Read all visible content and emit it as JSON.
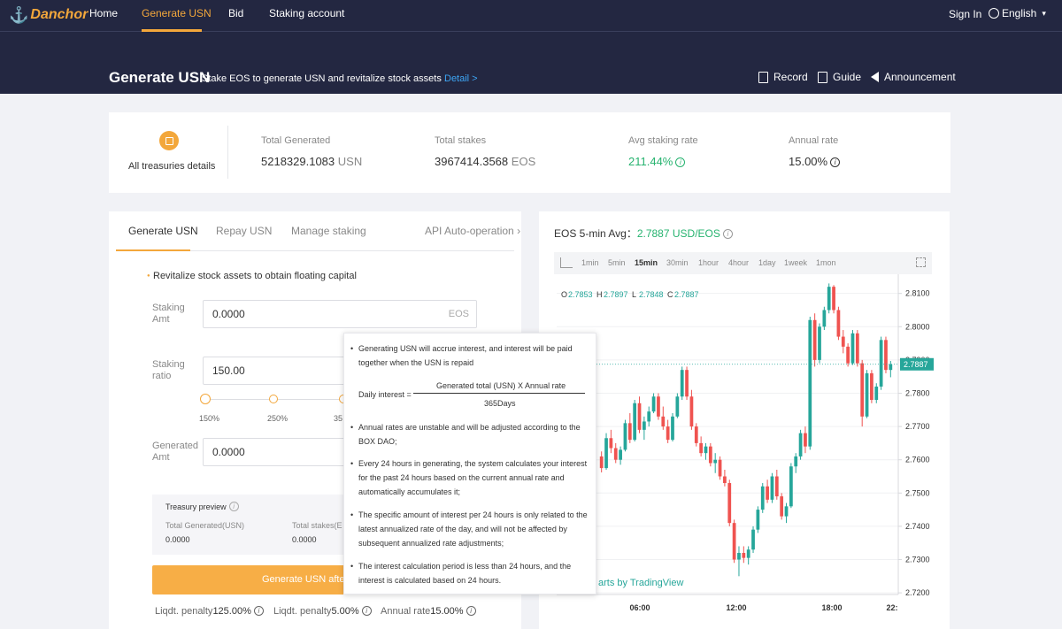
{
  "nav": {
    "logo": "Danchor",
    "items": [
      "Home",
      "Generate USN",
      "Bid",
      "Staking account"
    ],
    "signin": "Sign In",
    "language": "English"
  },
  "subheader": {
    "title": "Generate USN",
    "subtitle": "Stake EOS to generate USN and revitalize stock assets .",
    "detail": "Detail >",
    "links": [
      "Record",
      "Guide",
      "Announcement"
    ]
  },
  "stats": {
    "treasury_label": "All treasuries details",
    "total_generated_label": "Total Generated",
    "total_generated_value": "5218329.1083",
    "total_generated_unit": "USN",
    "total_stakes_label": "Total stakes",
    "total_stakes_value": "3967414.3568",
    "total_stakes_unit": "EOS",
    "avg_rate_label": "Avg staking rate",
    "avg_rate_value": "211.44%",
    "annual_rate_label": "Annual rate",
    "annual_rate_value": "15.00%"
  },
  "left": {
    "tabs": [
      "Generate USN",
      "Repay USN",
      "Manage staking"
    ],
    "api": "API Auto-operation",
    "bullet": "Revitalize stock assets to obtain floating capital",
    "staking_amt_label": "Staking Amt",
    "staking_amt_value": "0.0000",
    "staking_amt_unit": "EOS",
    "staking_ratio_label": "Staking ratio",
    "staking_ratio_value": "150.00",
    "slider_labels": [
      "150%",
      "250%",
      "35"
    ],
    "generated_amt_label": "Generated Amt",
    "generated_amt_value": "0.0000",
    "preview_title": "Treasury preview",
    "preview_total_gen_label": "Total Generated(USN)",
    "preview_total_gen_value": "0.0000",
    "preview_total_stakes_label": "Total stakes(E",
    "preview_total_stakes_value": "0.0000",
    "button": "Generate USN afte",
    "footer_1_label": "Liqdt. penalty",
    "footer_1_value": "125.00%",
    "footer_2_label": "Liqdt. penalty",
    "footer_2_value": "5.00%",
    "footer_3_label": "Annual rate",
    "footer_3_value": "15.00%"
  },
  "tooltip": {
    "item1": "Generating USN will accrue interest, and interest will be paid together when the USN is repaid",
    "formula_label": "Daily interest =",
    "formula_numerator": "Generated total (USN) X Annual rate",
    "formula_denominator": "365Days",
    "item2": "Annual rates are unstable and will be adjusted according to the BOX DAO;",
    "item3": "Every 24 hours in generating, the system calculates your interest for the past 24 hours based on the current annual rate and automatically accumulates it;",
    "item4": "The specific amount of interest per 24 hours is only related to the latest annualized rate of the day, and will not be affected by subsequent annualized rate adjustments;",
    "item5": "The interest calculation period is less than 24 hours, and the interest is calculated based on 24 hours."
  },
  "chart": {
    "title_prefix": "EOS 5-min Avg：",
    "title_value": "2.7887 USD/EOS",
    "intervals": [
      "1min",
      "5min",
      "15min",
      "30min",
      "1hour",
      "4hour",
      "1day",
      "1week",
      "1mon"
    ],
    "active_interval": "15min",
    "tradingview": "arts by TradingView"
  },
  "chart_data": {
    "type": "candlestick",
    "ohlc_legend": {
      "O": "2.7853",
      "H": "2.7897",
      "L": "2.7848",
      "C": "2.7887"
    },
    "y_ticks": [
      "2.8100",
      "2.8000",
      "2.7900",
      "2.7800",
      "2.7700",
      "2.7600",
      "2.7500",
      "2.7400",
      "2.7300",
      "2.7200"
    ],
    "x_ticks": [
      "06:00",
      "12:00",
      "18:00",
      "22:"
    ],
    "current_price": "2.7887",
    "ylim": [
      2.7195,
      2.8147
    ],
    "colors": {
      "up": "#26a69a",
      "down": "#ef5350"
    },
    "candles": [
      [
        2.761,
        2.7625,
        2.7562,
        2.7575
      ],
      [
        2.7575,
        2.768,
        2.757,
        2.7665
      ],
      [
        2.7665,
        2.769,
        2.762,
        2.7635
      ],
      [
        2.7635,
        2.765,
        2.759,
        2.76
      ],
      [
        2.76,
        2.764,
        2.7585,
        2.763
      ],
      [
        2.763,
        2.772,
        2.7625,
        2.771
      ],
      [
        2.771,
        2.774,
        2.765,
        2.766
      ],
      [
        2.766,
        2.778,
        2.7655,
        2.777
      ],
      [
        2.777,
        2.779,
        2.768,
        2.769
      ],
      [
        2.769,
        2.773,
        2.766,
        2.7715
      ],
      [
        2.7715,
        2.776,
        2.77,
        2.7745
      ],
      [
        2.7745,
        2.78,
        2.774,
        2.779
      ],
      [
        2.779,
        2.78,
        2.772,
        2.773
      ],
      [
        2.773,
        2.776,
        2.769,
        2.77
      ],
      [
        2.77,
        2.772,
        2.765,
        2.766
      ],
      [
        2.766,
        2.774,
        2.7655,
        2.773
      ],
      [
        2.773,
        2.78,
        2.7725,
        2.779
      ],
      [
        2.779,
        2.788,
        2.778,
        2.787
      ],
      [
        2.787,
        2.788,
        2.778,
        2.779
      ],
      [
        2.779,
        2.781,
        2.769,
        2.77
      ],
      [
        2.77,
        2.771,
        2.764,
        2.765
      ],
      [
        2.765,
        2.767,
        2.761,
        2.762
      ],
      [
        2.762,
        2.765,
        2.76,
        2.764
      ],
      [
        2.764,
        2.765,
        2.758,
        2.759
      ],
      [
        2.759,
        2.762,
        2.756,
        2.76
      ],
      [
        2.76,
        2.761,
        2.754,
        2.755
      ],
      [
        2.755,
        2.757,
        2.752,
        2.753
      ],
      [
        2.753,
        2.754,
        2.74,
        2.741
      ],
      [
        2.741,
        2.742,
        2.729,
        2.73
      ],
      [
        2.73,
        2.734,
        2.725,
        2.732
      ],
      [
        2.732,
        2.734,
        2.729,
        2.7305
      ],
      [
        2.7305,
        2.734,
        2.7285,
        2.733
      ],
      [
        2.733,
        2.74,
        2.732,
        2.739
      ],
      [
        2.739,
        2.746,
        2.738,
        2.745
      ],
      [
        2.745,
        2.753,
        2.744,
        2.752
      ],
      [
        2.752,
        2.754,
        2.747,
        2.748
      ],
      [
        2.748,
        2.756,
        2.747,
        2.755
      ],
      [
        2.755,
        2.757,
        2.748,
        2.749
      ],
      [
        2.749,
        2.75,
        2.742,
        2.743
      ],
      [
        2.743,
        2.747,
        2.741,
        2.746
      ],
      [
        2.746,
        2.759,
        2.7455,
        2.758
      ],
      [
        2.758,
        2.762,
        2.756,
        2.761
      ],
      [
        2.761,
        2.769,
        2.76,
        2.768
      ],
      [
        2.768,
        2.77,
        2.762,
        2.764
      ],
      [
        2.764,
        2.803,
        2.763,
        2.802
      ],
      [
        2.802,
        2.804,
        2.788,
        2.79
      ],
      [
        2.79,
        2.801,
        2.789,
        2.8
      ],
      [
        2.8,
        2.806,
        2.799,
        2.805
      ],
      [
        2.805,
        2.813,
        2.804,
        2.812
      ],
      [
        2.812,
        2.8125,
        2.804,
        2.805
      ],
      [
        2.805,
        2.806,
        2.796,
        2.797
      ],
      [
        2.797,
        2.799,
        2.792,
        2.794
      ],
      [
        2.794,
        2.795,
        2.788,
        2.789
      ],
      [
        2.789,
        2.799,
        2.7885,
        2.798
      ],
      [
        2.798,
        2.799,
        2.788,
        2.789
      ],
      [
        2.789,
        2.79,
        2.77,
        2.773
      ],
      [
        2.773,
        2.787,
        2.7725,
        2.786
      ],
      [
        2.786,
        2.787,
        2.777,
        2.778
      ],
      [
        2.778,
        2.783,
        2.777,
        2.782
      ],
      [
        2.782,
        2.797,
        2.781,
        2.796
      ],
      [
        2.796,
        2.797,
        2.786,
        2.787
      ],
      [
        2.787,
        2.7897,
        2.7848,
        2.7887
      ]
    ]
  }
}
